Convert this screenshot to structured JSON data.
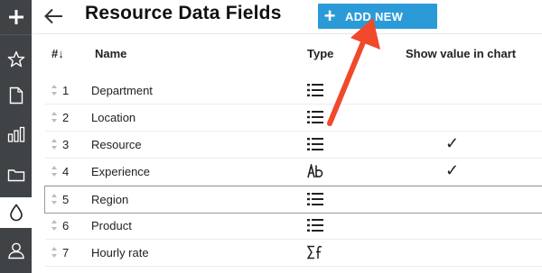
{
  "sidebar": {
    "items": [
      {
        "icon": "plus-icon"
      },
      {
        "icon": "star-icon"
      },
      {
        "icon": "document-icon"
      },
      {
        "icon": "bar-chart-icon"
      },
      {
        "icon": "folder-icon"
      },
      {
        "icon": "drop-icon",
        "active": true
      },
      {
        "icon": "user-icon"
      }
    ]
  },
  "header": {
    "back_icon": "arrow-left-icon",
    "title": "Resource Data Fields",
    "add_button_plus": "+",
    "add_button_label": "ADD NEW"
  },
  "table": {
    "columns": {
      "order": "#↓",
      "name": "Name",
      "type": "Type",
      "chart": "Show value in chart"
    },
    "rows": [
      {
        "num": "1",
        "name": "Department",
        "type": "list-icon",
        "chart": ""
      },
      {
        "num": "2",
        "name": "Location",
        "type": "list-icon",
        "chart": ""
      },
      {
        "num": "3",
        "name": "Resource",
        "type": "list-icon",
        "chart": "✓"
      },
      {
        "num": "4",
        "name": "Experience",
        "type": "text-icon",
        "chart": "✓"
      },
      {
        "num": "5",
        "name": "Region",
        "type": "list-icon",
        "chart": "",
        "selected": true
      },
      {
        "num": "6",
        "name": "Product",
        "type": "list-icon",
        "chart": ""
      },
      {
        "num": "7",
        "name": "Hourly rate",
        "type": "formula-icon",
        "chart": ""
      }
    ]
  },
  "colors": {
    "rail_bg": "#3f4346",
    "accent": "#2b9bd8",
    "annotation_arrow": "#f0492b"
  }
}
